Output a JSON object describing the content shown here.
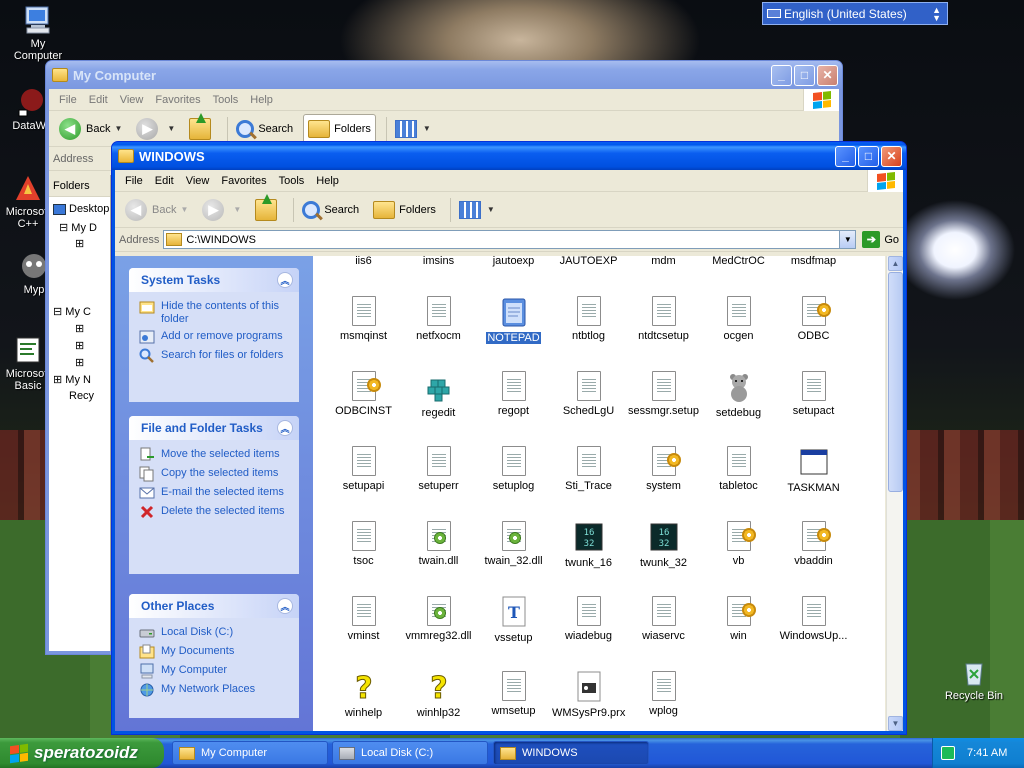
{
  "desktop": {
    "icons": [
      {
        "label": "My Computer"
      },
      {
        "label": "DataWa"
      },
      {
        "label": "Microsoft C++"
      },
      {
        "label": "Myp"
      },
      {
        "label": "Microsoft Basic"
      },
      {
        "label": "Recycle Bin"
      }
    ],
    "language_bar": "English (United States)"
  },
  "back_window": {
    "title": "My Computer",
    "menu": [
      "File",
      "Edit",
      "View",
      "Favorites",
      "Tools",
      "Help"
    ],
    "toolbar": {
      "back": "Back",
      "search": "Search",
      "folders": "Folders"
    },
    "address_label": "Address",
    "folders_label": "Folders",
    "tree": [
      {
        "label": "Desktop"
      },
      {
        "label": "My D"
      },
      {
        "label": "My C"
      },
      {
        "label": "My N"
      },
      {
        "label": "Recy"
      }
    ]
  },
  "front_window": {
    "title": "WINDOWS",
    "menu": [
      "File",
      "Edit",
      "View",
      "Favorites",
      "Tools",
      "Help"
    ],
    "toolbar": {
      "back": "Back",
      "search": "Search",
      "folders": "Folders"
    },
    "address_label": "Address",
    "address_value": "C:\\WINDOWS",
    "go_label": "Go",
    "task_sections": [
      {
        "title": "System Tasks",
        "items": [
          "Hide the contents of this folder",
          "Add or remove programs",
          "Search for files or folders"
        ]
      },
      {
        "title": "File and Folder Tasks",
        "items": [
          "Move the selected items",
          "Copy the selected items",
          "E-mail the selected items",
          "Delete the selected items"
        ]
      },
      {
        "title": "Other Places",
        "items": [
          "Local Disk (C:)",
          "My Documents",
          "My Computer",
          "My Network Places"
        ]
      }
    ],
    "files": [
      [
        "iis6",
        "imsins",
        "jautoexp",
        "JAUTOEXP",
        "mdm",
        "MedCtrOC",
        "msdfmap"
      ],
      [
        "msmqinst",
        "netfxocm",
        "NOTEPAD",
        "ntbtlog",
        "ntdtcsetup",
        "ocgen",
        "ODBC"
      ],
      [
        "ODBCINST",
        "regedit",
        "regopt",
        "SchedLgU",
        "sessmgr.setup",
        "setdebug",
        "setupact"
      ],
      [
        "setupapi",
        "setuperr",
        "setuplog",
        "Sti_Trace",
        "system",
        "tabletoc",
        "TASKMAN"
      ],
      [
        "tsoc",
        "twain.dll",
        "twain_32.dll",
        "twunk_16",
        "twunk_32",
        "vb",
        "vbaddin"
      ],
      [
        "vminst",
        "vmmreg32.dll",
        "vssetup",
        "wiadebug",
        "wiaservc",
        "win",
        "WindowsUp..."
      ],
      [
        "winhelp",
        "winhlp32",
        "wmsetup",
        "WMSysPr9.prx",
        "wplog"
      ]
    ],
    "selected_file": "NOTEPAD"
  },
  "taskbar": {
    "start_label": "speratozoidz",
    "tasks": [
      "My Computer",
      "Local Disk (C:)",
      "WINDOWS"
    ],
    "active_task": "WINDOWS",
    "clock": "7:41 AM"
  },
  "colors": {
    "title_active": "#0054e3",
    "taskpane_link": "#215dc6",
    "selection": "#316ac5",
    "start_green": "#3c9a3c"
  }
}
